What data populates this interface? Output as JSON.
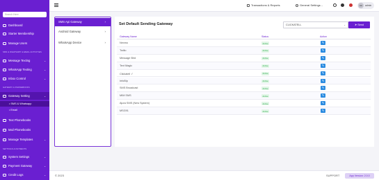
{
  "sidebar": {
    "search_placeholder": "Search Here",
    "items": {
      "dashboard": "Dashboard",
      "starter_membership": "Starter Membership",
      "manage_users": "Manage Users",
      "message_texting": "Message Texting",
      "whatsapp_texting": "WhatsApp Texting",
      "inbox_control": "Inbox Control",
      "gateway_setting": "Gateway Setting",
      "sms_whatsapp": "SMS & Whatsapp",
      "email": "Email",
      "text_phonebooks": "Text Phonebooks",
      "mail_phonebooks": "Mail Phonebooks",
      "manage_templates": "Manage Templates",
      "system_settings": "System Settings",
      "payment_gateway": "Payment Gateway",
      "credit_logs": "Credit Logs"
    },
    "sections": {
      "sms": "SMS & WHATSAPP & EMAIL ACTIVITIES",
      "gateway": "GATEWAY & PHONEBOOKS",
      "settings": "SETTINGS & PAYMENTS"
    }
  },
  "topbar": {
    "transactions": "Transactions & Reports",
    "general_settings": "General Settings",
    "avatar_initials": "AA",
    "user_name": "admin"
  },
  "left_panel": {
    "items": [
      "SMS Api Gateway",
      "Android Gateway",
      "WhatsApp Device"
    ]
  },
  "main": {
    "title": "Set Default Sending Gateway",
    "selected_gateway": "CLICKATELL",
    "send_label": "Send",
    "headers": {
      "name": "Gateway Name",
      "status": "Status",
      "action": "Action"
    },
    "rows": [
      {
        "name": "Nexmo",
        "status": "Active"
      },
      {
        "name": "Twilio",
        "status": "Active"
      },
      {
        "name": "Message Bird",
        "status": "Active"
      },
      {
        "name": "Text Magic",
        "status": "Active"
      },
      {
        "name": "Clickatell ✓",
        "status": "Active"
      },
      {
        "name": "InfoBip",
        "status": "Active"
      },
      {
        "name": "SMS Broadcast",
        "status": "Active"
      },
      {
        "name": "MIM SMS",
        "status": "Active"
      },
      {
        "name": "Ajura SMS (New System)",
        "status": "Active"
      },
      {
        "name": "MSG91",
        "status": "Active"
      }
    ]
  },
  "footer": {
    "copyright": "© 2023",
    "support": "SUPPORT",
    "version": "App Version: 2.0.0"
  },
  "colors": {
    "primary": "#6a1fd1",
    "action": "#2a8be0",
    "active_badge": "#2aa84a"
  }
}
